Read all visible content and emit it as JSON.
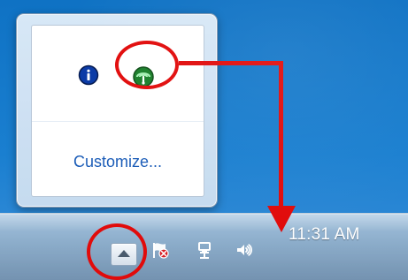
{
  "screen": {
    "theme": "Windows 7 taskbar / notification area"
  },
  "tray_popup": {
    "customize_label": "Customize...",
    "icons": [
      {
        "name": "information-icon",
        "color": "#0a3aa6"
      },
      {
        "name": "network-status-icon",
        "color": "#1a7f2a"
      }
    ]
  },
  "taskbar": {
    "chevron_icon": "chevron-up-icon",
    "tray_icons": [
      {
        "name": "action-center-flag-icon",
        "has_error_badge": true
      },
      {
        "name": "network-icon"
      },
      {
        "name": "speaker-icon"
      }
    ],
    "clock_time": "11:31 AM",
    "clock_date": ""
  },
  "annotations": {
    "color": "#e10b0b"
  }
}
